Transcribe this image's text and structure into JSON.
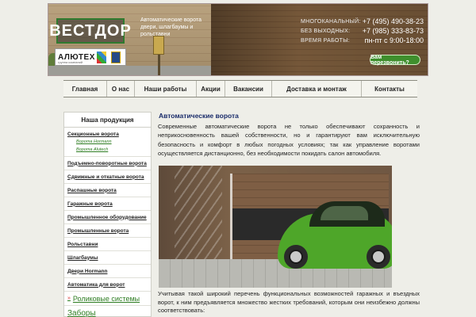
{
  "header": {
    "logo_text": "ВЕСТДОР",
    "partner_brand": "АЛЮТЕХ",
    "partner_tagline": "группа компаний",
    "tagline": "Автоматические ворота двери, шлагбаумы и рольставни",
    "contacts": [
      {
        "label": "МНОГОКАНАЛЬНЫЙ:",
        "value": "+7 (495) 490-38-23"
      },
      {
        "label": "БЕЗ ВЫХОДНЫХ:",
        "value": "+7 (985) 333-83-73"
      },
      {
        "label": "ВРЕМЯ РАБОТЫ:",
        "value": "пн-пт с 9:00-18:00"
      }
    ],
    "callback_label": "Вам перезвонить?"
  },
  "nav": {
    "items": [
      "Главная",
      "О нас",
      "Наши работы",
      "Акции",
      "Вакансии",
      "Доставка и монтаж",
      "Контакты"
    ]
  },
  "sidebar": {
    "title": "Наша продукция",
    "items": [
      {
        "label": "Секционные ворота"
      },
      {
        "label": "Ворота Hormann",
        "sub": true
      },
      {
        "label": "Ворота Alutech",
        "sub": true
      },
      {
        "label": "Подъемно-поворотные ворота"
      },
      {
        "label": "Сдвижные и откатные ворота"
      },
      {
        "label": "Распашные ворота"
      },
      {
        "label": "Гаражные ворота"
      },
      {
        "label": "Промышленное оборудование"
      },
      {
        "label": "Промышленные ворота"
      },
      {
        "label": "Рольставни"
      },
      {
        "label": "Шлагбаумы"
      },
      {
        "label": "Двери Hormann"
      },
      {
        "label": "Автоматика для ворот"
      }
    ],
    "green_items": [
      "Роликовые системы",
      "Заборы"
    ]
  },
  "main": {
    "title": "Автоматические ворота",
    "paragraph1": "Современные автоматические ворота не только обеспечивают сохранность и неприкосновенность вашей собственности, но и гарантируют вам исключительную безопасность и комфорт в любых погодных условиях; так как управление воротами осуществляется дистанционно, без необходимости покидать салон автомобиля.",
    "paragraph2": "Учитывая такой широкий перечень функциональных возможностей гаражных и въездных ворот, к ним предъявляется множество жестких требований, которым они неизбежно должны соответствовать:"
  },
  "colors": {
    "accent_green": "#3f8f2d",
    "title_blue": "#1b2d6b",
    "link_green": "#2e7d22"
  }
}
